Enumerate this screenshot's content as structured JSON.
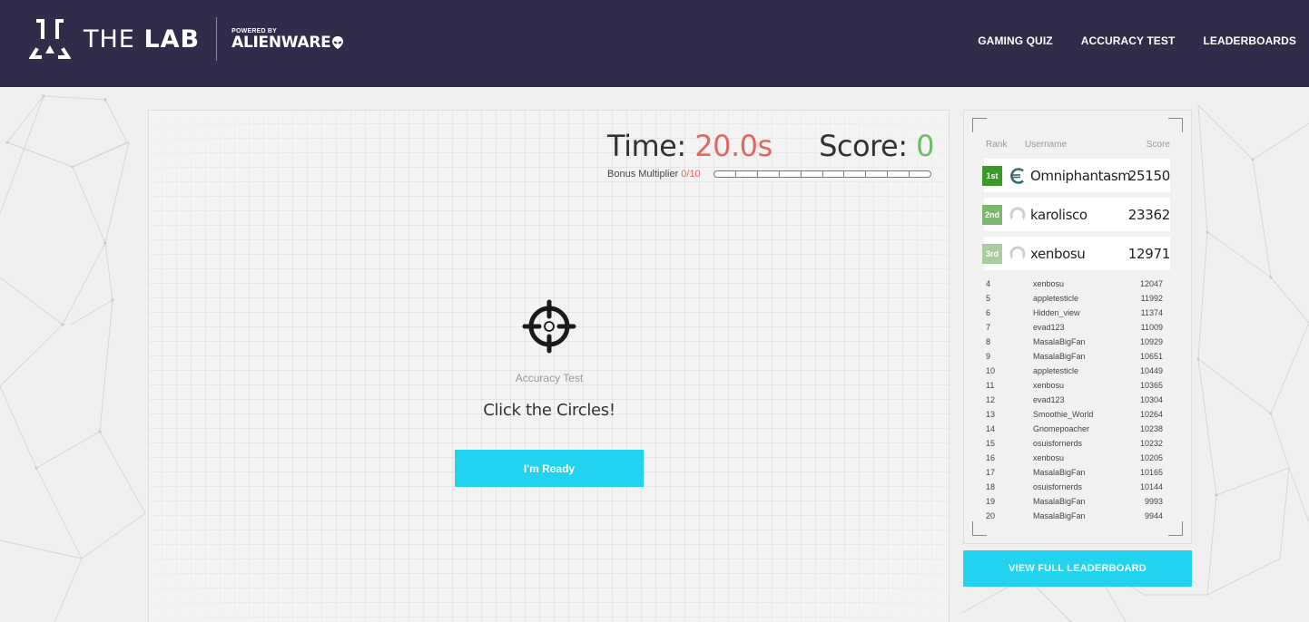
{
  "header": {
    "brand": {
      "name_light": "THE ",
      "name_bold": "LAB",
      "powered_by": "POWERED BY",
      "partner": "ALIENWARE",
      "logo_icon": "lab-logo-icon",
      "partner_icon": "alien-head-icon"
    },
    "nav": [
      {
        "label": "GAMING QUIZ"
      },
      {
        "label": "ACCURACY TEST"
      },
      {
        "label": "LEADERBOARDS"
      }
    ]
  },
  "colors": {
    "header_bg": "#302c49",
    "accent_cyan": "#22d3f0",
    "time_red": "#e06766",
    "score_green": "#6dbd63",
    "rank1": "#3a9a27",
    "rank2": "#7db66f",
    "rank3": "#a9cd9f"
  },
  "game": {
    "time_label": "Time: ",
    "time_value": "20.0s",
    "score_label": "Score: ",
    "score_value": "0",
    "bonus_label": "Bonus Multiplier",
    "bonus_value": "0/10",
    "bonus_progress": 0,
    "bonus_segments": 10,
    "icon": "crosshair-icon",
    "subtitle": "Accuracy Test",
    "title": "Click the Circles!",
    "ready_button": "I'm Ready"
  },
  "leaderboard": {
    "headers": {
      "rank": "Rank",
      "username": "Username",
      "score": "Score"
    },
    "top": [
      {
        "rank": "1st",
        "username": "Omniphantasm",
        "score": "25150",
        "avatar": "euro-logo-avatar"
      },
      {
        "rank": "2nd",
        "username": "karolisco",
        "score": "23362",
        "avatar": "default-user-avatar"
      },
      {
        "rank": "3rd",
        "username": "xenbosu",
        "score": "12971",
        "avatar": "default-user-avatar"
      }
    ],
    "rows": [
      {
        "rank": "4",
        "username": "xenbosu",
        "score": "12047"
      },
      {
        "rank": "5",
        "username": "appletesticle",
        "score": "11992"
      },
      {
        "rank": "6",
        "username": "Hidden_view",
        "score": "11374"
      },
      {
        "rank": "7",
        "username": "evad123",
        "score": "11009"
      },
      {
        "rank": "8",
        "username": "MasalaBigFan",
        "score": "10929"
      },
      {
        "rank": "9",
        "username": "MasalaBigFan",
        "score": "10651"
      },
      {
        "rank": "10",
        "username": "appletesticle",
        "score": "10449"
      },
      {
        "rank": "11",
        "username": "xenbosu",
        "score": "10365"
      },
      {
        "rank": "12",
        "username": "evad123",
        "score": "10304"
      },
      {
        "rank": "13",
        "username": "Smoothie_World",
        "score": "10264"
      },
      {
        "rank": "14",
        "username": "Gnomepoacher",
        "score": "10238"
      },
      {
        "rank": "15",
        "username": "osuisfornerds",
        "score": "10232"
      },
      {
        "rank": "16",
        "username": "xenbosu",
        "score": "10205"
      },
      {
        "rank": "17",
        "username": "MasalaBigFan",
        "score": "10165"
      },
      {
        "rank": "18",
        "username": "osuisfornerds",
        "score": "10144"
      },
      {
        "rank": "19",
        "username": "MasalaBigFan",
        "score": "9993"
      },
      {
        "rank": "20",
        "username": "MasalaBigFan",
        "score": "9944"
      }
    ],
    "view_full_button": "VIEW FULL LEADERBOARD"
  }
}
